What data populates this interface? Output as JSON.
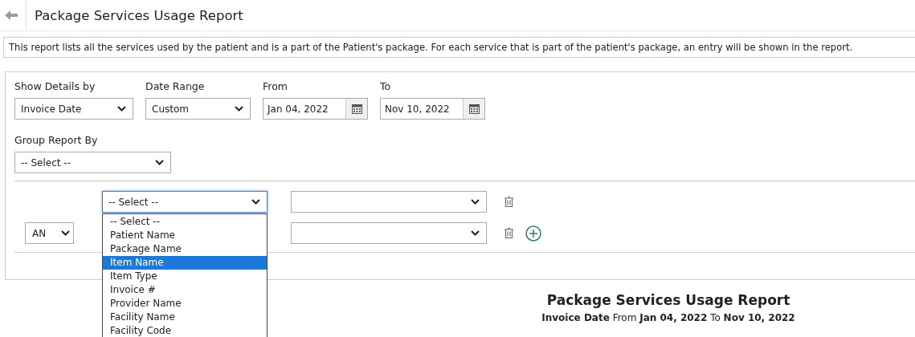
{
  "header": {
    "title": "Package Services Usage Report"
  },
  "description": "This report lists all the services used by the patient and is a part of the Patient's package. For each service that is part of the patient's package, an entry will be shown in the report.",
  "filters": [
    {
      "kind": "select",
      "label": "Show Details by",
      "value": "Invoice Date"
    },
    {
      "kind": "select",
      "label": "Date Range",
      "value": "Custom"
    },
    {
      "kind": "date",
      "label": "From",
      "value": "Jan 04, 2022"
    },
    {
      "kind": "date",
      "label": "To",
      "value": "Nov 10, 2022"
    }
  ],
  "group_by": {
    "label": "Group Report By",
    "value": "-- Select --"
  },
  "conditions": [
    {
      "field": "-- Select --",
      "focused": true,
      "expanded": true,
      "add": false,
      "options": [
        {
          "label": "-- Select --",
          "selected": false
        },
        {
          "label": "Patient Name",
          "selected": false
        },
        {
          "label": "Package Name",
          "selected": false
        },
        {
          "label": "Item Name",
          "selected": true
        },
        {
          "label": "Item Type",
          "selected": false
        },
        {
          "label": "Invoice #",
          "selected": false
        },
        {
          "label": "Provider Name",
          "selected": false
        },
        {
          "label": "Facility Name",
          "selected": false
        },
        {
          "label": "Facility Code",
          "selected": false
        }
      ]
    },
    {
      "connector": "AN",
      "add": true
    }
  ],
  "report": {
    "title": "Package Services Usage Report",
    "subtitle": "**Invoice Date** From **Jan 04, 2022** To **Nov 10, 2022**"
  }
}
